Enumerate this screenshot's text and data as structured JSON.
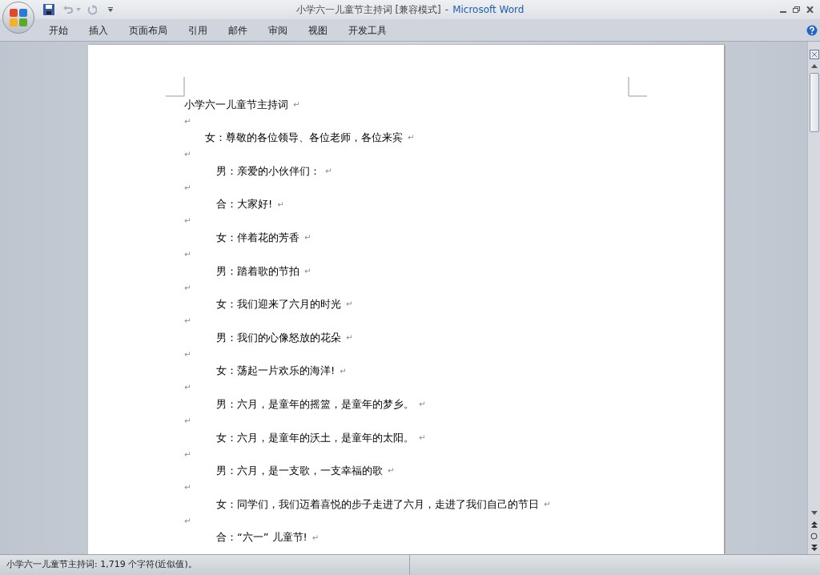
{
  "window": {
    "title": "小学六一儿童节主持词 [兼容模式]",
    "separator": "-",
    "app": "Microsoft Word"
  },
  "ribbon_tabs": [
    {
      "label": "开始"
    },
    {
      "label": "插入"
    },
    {
      "label": "页面布局"
    },
    {
      "label": "引用"
    },
    {
      "label": "邮件"
    },
    {
      "label": "审阅"
    },
    {
      "label": "视图"
    },
    {
      "label": "开发工具"
    }
  ],
  "document": {
    "paragraphs": [
      {
        "kind": "title",
        "text": "小学六一儿童节主持词",
        "mark": "↵"
      },
      {
        "kind": "empty",
        "mark": "↵"
      },
      {
        "kind": "speech_first",
        "text": "女：尊敬的各位领导、各位老师，各位来宾",
        "mark": "↵"
      },
      {
        "kind": "empty",
        "mark": "↵"
      },
      {
        "kind": "speech",
        "text": "男：亲爱的小伙伴们：",
        "mark": "↵"
      },
      {
        "kind": "empty",
        "mark": "↵"
      },
      {
        "kind": "speech",
        "text": "合：大家好!",
        "mark": "↵"
      },
      {
        "kind": "empty",
        "mark": "↵"
      },
      {
        "kind": "speech",
        "text": "女：伴着花的芳香",
        "mark": "↵"
      },
      {
        "kind": "empty",
        "mark": "↵"
      },
      {
        "kind": "speech",
        "text": "男：踏着歌的节拍",
        "mark": "↵"
      },
      {
        "kind": "empty",
        "mark": "↵"
      },
      {
        "kind": "speech",
        "text": "女：我们迎来了六月的时光",
        "mark": "↵"
      },
      {
        "kind": "empty",
        "mark": "↵"
      },
      {
        "kind": "speech",
        "text": "男：我们的心像怒放的花朵",
        "mark": "↵"
      },
      {
        "kind": "empty",
        "mark": "↵"
      },
      {
        "kind": "speech",
        "text": "女：荡起一片欢乐的海洋!",
        "mark": "↵"
      },
      {
        "kind": "empty",
        "mark": "↵"
      },
      {
        "kind": "speech",
        "text": "男：六月，是童年的摇篮，是童年的梦乡。",
        "mark": "↵"
      },
      {
        "kind": "empty",
        "mark": "↵"
      },
      {
        "kind": "speech",
        "text": "女：六月，是童年的沃土，是童年的太阳。",
        "mark": "↵"
      },
      {
        "kind": "empty",
        "mark": "↵"
      },
      {
        "kind": "speech",
        "text": "男：六月，是一支歌，一支幸福的歌",
        "mark": "↵"
      },
      {
        "kind": "empty",
        "mark": "↵"
      },
      {
        "kind": "speech",
        "text": "女：同学们，我们迈着喜悦的步子走进了六月，走进了我们自己的节日",
        "mark": "↵"
      },
      {
        "kind": "empty",
        "mark": "↵"
      },
      {
        "kind": "speech",
        "text": "合：“六一” 儿童节!",
        "mark": "↵"
      }
    ]
  },
  "status_bar": {
    "text": "小学六一儿童节主持词: 1,719 个字符(近似值)。"
  }
}
